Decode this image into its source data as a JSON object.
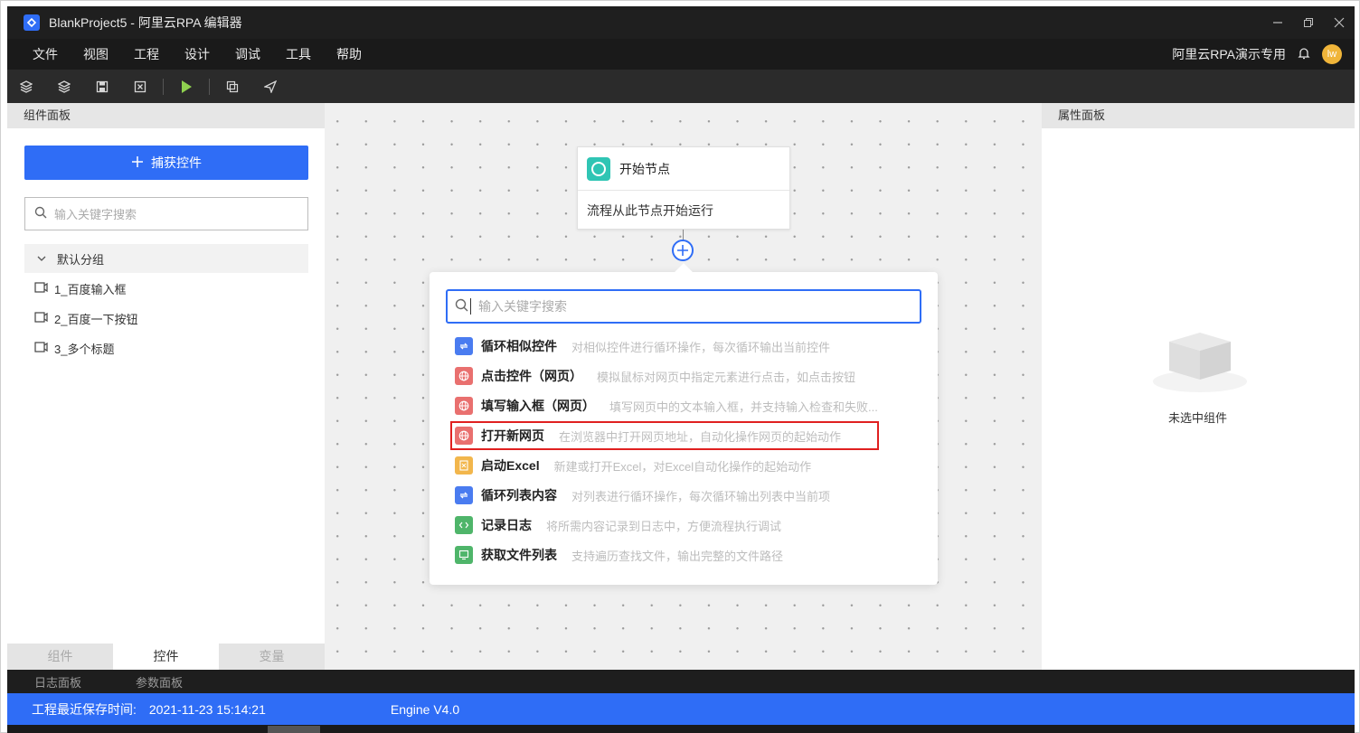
{
  "window": {
    "title": "BlankProject5 - 阿里云RPA 编辑器",
    "controls": [
      "minimize-icon",
      "restore-icon",
      "close-icon"
    ]
  },
  "menu": [
    "文件",
    "视图",
    "工程",
    "设计",
    "调试",
    "工具",
    "帮助"
  ],
  "user": {
    "name": "阿里云RPA演示专用",
    "avatar_text": "lw"
  },
  "toolbar": [
    "layers-icon",
    "layers-alt-icon",
    "save-icon",
    "close-box-icon",
    "run-icon",
    "copy-icon",
    "send-icon"
  ],
  "left_panel": {
    "title": "组件面板",
    "capture_label": "捕获控件",
    "search_placeholder": "输入关键字搜索",
    "group": "默认分组",
    "controls": [
      "1_百度输入框",
      "2_百度一下按钮",
      "3_多个标题"
    ],
    "tabs": [
      "组件",
      "控件",
      "变量"
    ],
    "active_tab": "控件"
  },
  "canvas": {
    "start_node": {
      "title": "开始节点",
      "desc": "流程从此节点开始运行"
    },
    "popup": {
      "search_placeholder": "输入关键字搜索",
      "items": [
        {
          "name": "循环相似控件",
          "desc": "对相似控件进行循环操作，每次循环输出当前控件",
          "icon": "loop-icon",
          "color": "#4a7cf0"
        },
        {
          "name": "点击控件（网页）",
          "desc": "模拟鼠标对网页中指定元素进行点击，如点击按钮",
          "icon": "globe-icon",
          "color": "#e9706f"
        },
        {
          "name": "填写输入框（网页）",
          "desc": "填写网页中的文本输入框，并支持输入检查和失败...",
          "icon": "globe-icon",
          "color": "#e9706f"
        },
        {
          "name": "打开新网页",
          "desc": "在浏览器中打开网页地址，自动化操作网页的起始动作",
          "icon": "globe-icon",
          "color": "#e9706f"
        },
        {
          "name": "启动Excel",
          "desc": "新建或打开Excel，对Excel自动化操作的起始动作",
          "icon": "excel-icon",
          "color": "#f2b64c"
        },
        {
          "name": "循环列表内容",
          "desc": "对列表进行循环操作，每次循环输出列表中当前项",
          "icon": "loop-icon",
          "color": "#4a7cf0"
        },
        {
          "name": "记录日志",
          "desc": "将所需内容记录到日志中，方便流程执行调试",
          "icon": "code-icon",
          "color": "#4fb56a"
        },
        {
          "name": "获取文件列表",
          "desc": "支持遍历查找文件，输出完整的文件路径",
          "icon": "monitor-icon",
          "color": "#4fb56a"
        }
      ],
      "highlighted_item": "打开新网页"
    }
  },
  "right_panel": {
    "title": "属性面板",
    "empty_text": "未选中组件"
  },
  "log_tabs": [
    "日志面板",
    "参数面板"
  ],
  "status": {
    "save_label": "工程最近保存时间:",
    "save_time": "2021-11-23 15:14:21",
    "engine": "Engine V4.0"
  },
  "colors": {
    "accent": "#2f6df6",
    "highlight_border": "#e02020"
  }
}
